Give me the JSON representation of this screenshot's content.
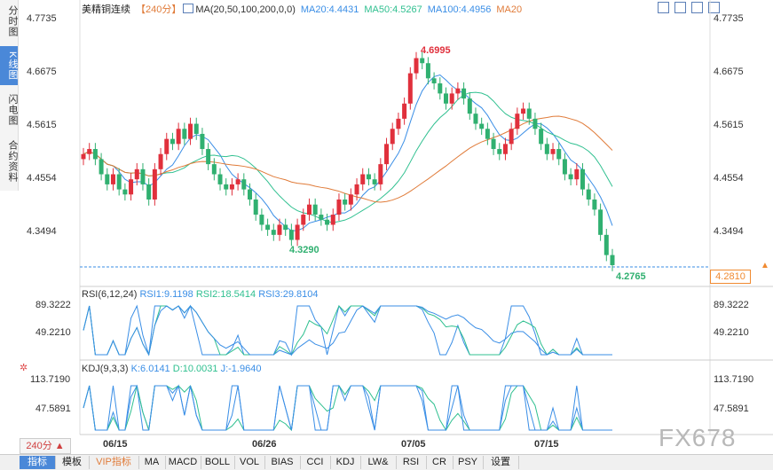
{
  "left_tabs": [
    "分时图",
    "K线图",
    "闪电图",
    "合约资料"
  ],
  "legend": {
    "title": "美精铜连续",
    "period": "【240分】",
    "ma_label": "MA(20,50,100,200,0,0)",
    "ma20": "MA20:4.4431",
    "ma50": "MA50:4.5267",
    "ma100": "MA100:4.4956",
    "ma200": "MA20"
  },
  "price_axis": [
    "4.7735",
    "4.6675",
    "4.5615",
    "4.4554",
    "4.3494"
  ],
  "price_tag": "4.2810",
  "annotations": {
    "high": "4.6995",
    "low1": "4.3290",
    "low2": "4.2765"
  },
  "rsi": {
    "title": "RSI(6,12,24)",
    "rsi1": "RSI1:9.1198",
    "rsi2": "RSI2:18.5414",
    "rsi3": "RSI3:29.8104",
    "ticks": [
      "89.3222",
      "49.2210"
    ]
  },
  "kdj": {
    "title": "KDJ(9,3,3)",
    "k": "K:6.0141",
    "d": "D:10.0031",
    "j": "J:-1.9640",
    "ticks": [
      "113.7190",
      "47.5891"
    ]
  },
  "dates": [
    "06/15",
    "06/26",
    "07/05",
    "07/15"
  ],
  "period_selector": "240分 ▲",
  "bottom_tabs": [
    "指标",
    "模板",
    "VIP指标",
    "MA",
    "MACD",
    "BOLL",
    "VOL",
    "BIAS",
    "CCI",
    "KDJ",
    "LW&",
    "RSI",
    "CR",
    "PSY",
    "设置"
  ],
  "watermark": "FX678",
  "colors": {
    "up": "#e0303c",
    "down": "#30b070",
    "ma20": "#3a8ee6",
    "ma50": "#30c090",
    "ma100": "#e8a030",
    "ma200": "#e07b39",
    "axis_accent": "#f08a30"
  },
  "chart_data": {
    "type": "candlestick",
    "ylim": [
      4.2765,
      4.7735
    ],
    "close": [
      4.5,
      4.51,
      4.49,
      4.46,
      4.44,
      4.46,
      4.43,
      4.42,
      4.45,
      4.47,
      4.44,
      4.41,
      4.47,
      4.5,
      4.53,
      4.52,
      4.55,
      4.53,
      4.56,
      4.54,
      4.51,
      4.48,
      4.46,
      4.44,
      4.43,
      4.44,
      4.45,
      4.43,
      4.41,
      4.38,
      4.36,
      4.35,
      4.34,
      4.36,
      4.35,
      4.33,
      4.36,
      4.38,
      4.4,
      4.38,
      4.37,
      4.36,
      4.38,
      4.41,
      4.4,
      4.42,
      4.44,
      4.46,
      4.45,
      4.44,
      4.48,
      4.52,
      4.55,
      4.57,
      4.6,
      4.66,
      4.69,
      4.68,
      4.65,
      4.64,
      4.62,
      4.6,
      4.62,
      4.63,
      4.61,
      4.58,
      4.56,
      4.55,
      4.53,
      4.51,
      4.5,
      4.52,
      4.55,
      4.58,
      4.59,
      4.57,
      4.55,
      4.52,
      4.5,
      4.51,
      4.49,
      4.46,
      4.45,
      4.47,
      4.43,
      4.41,
      4.39,
      4.34,
      4.3,
      4.28
    ]
  }
}
